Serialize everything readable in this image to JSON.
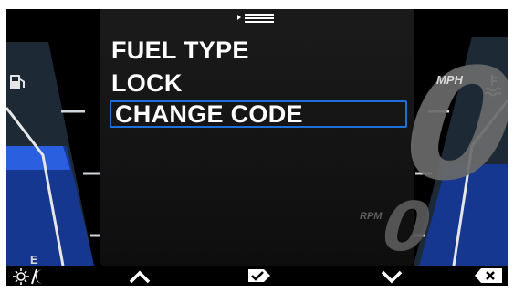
{
  "menu": {
    "items": [
      {
        "label": "FUEL TYPE",
        "selected": false
      },
      {
        "label": "LOCK",
        "selected": false
      },
      {
        "label": "CHANGE CODE",
        "selected": true
      }
    ],
    "highlight_color": "#1e6fd8"
  },
  "gauges": {
    "speed_value": "0",
    "speed_unit": "MPH",
    "rpm_value": "0",
    "rpm_unit": "RPM",
    "fuel_empty_label": "E",
    "accent_color": "#1a3fa8"
  },
  "bottom_bar": {
    "buttons": [
      {
        "name": "day-night",
        "icon": "sun-moon-icon"
      },
      {
        "name": "up",
        "icon": "chevron-up-icon"
      },
      {
        "name": "confirm",
        "icon": "check-tag-icon"
      },
      {
        "name": "down",
        "icon": "chevron-down-icon"
      },
      {
        "name": "delete",
        "icon": "backspace-x-icon"
      }
    ]
  }
}
